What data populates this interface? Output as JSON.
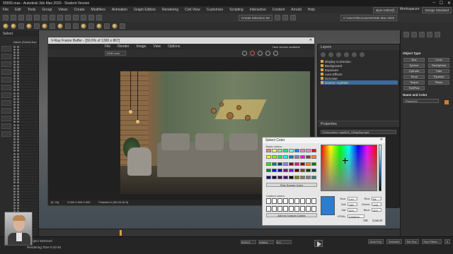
{
  "titlebar": {
    "title": "55555.max - Autodesk 3ds Max 2020 - Student Version"
  },
  "menubar": {
    "items": [
      "File",
      "Edit",
      "Tools",
      "Group",
      "Views",
      "Create",
      "Modifiers",
      "Animation",
      "Graph Editors",
      "Rendering",
      "Civil View",
      "Customize",
      "Scripting",
      "Interactive",
      "Content",
      "Arnold",
      "Help"
    ],
    "user": "alym-m6b4@",
    "workspace_label": "Workspaces:",
    "workspace_value": "Design Standard"
  },
  "toolbar": {
    "selection_set": "Create Selection Se",
    "path": "C:\\Users\\\\Documents\\3ds Max 2020"
  },
  "leftpanel": {
    "header": "Select",
    "column_header": "Name (Sorted Asc"
  },
  "vfb": {
    "title": "V-Ray Frame Buffer - [50.0% of 1300 x 867]",
    "menu": [
      "File",
      "Render",
      "Image",
      "View",
      "Options"
    ],
    "channel": "RGB color",
    "new_version": "New version available",
    "status_left": "[0, 40]",
    "status_mid": "0.000 0.000 0.000",
    "status_right": "Finished in [00:09:16.5]"
  },
  "layers": {
    "header": "Layers",
    "items": [
      {
        "label": "Display Correction",
        "sel": false
      },
      {
        "label": "Background",
        "sel": false
      },
      {
        "label": "Exposure",
        "sel": false
      },
      {
        "label": "Lens Effects",
        "sel": false
      },
      {
        "label": "Denoiser",
        "sel": false
      },
      {
        "label": "Source: LightMix",
        "sel": true
      }
    ],
    "props_header": "Properties",
    "props_field": "Photometric Light001_VRaySkyLight"
  },
  "cmdpanel": {
    "section1": "Object Type",
    "buttons": [
      "Box",
      "Cone",
      "Sphere",
      "GeoSphere",
      "Cylinder",
      "Tube",
      "Torus",
      "Pyramid",
      "Teapot",
      "Plane",
      "TextPlus"
    ],
    "section2": "Name and Color",
    "name_value": "Plane012"
  },
  "colordlg": {
    "title": "Select Color",
    "basic_label": "Basic colors:",
    "pick_label": "Pick Screen Color",
    "custom_label": "Custom colors:",
    "add_label": "Add to Custom Colors",
    "fields": [
      {
        "n": "Hue:",
        "v": "210"
      },
      {
        "n": "Sat:",
        "v": "190"
      },
      {
        "n": "Val:",
        "v": "203"
      },
      {
        "n": "Red:",
        "v": "54"
      },
      {
        "n": "Green:",
        "v": "128"
      },
      {
        "n": "Blue:",
        "v": "203"
      }
    ],
    "html_label": "HTML:",
    "html_value": "#3680cb",
    "ok": "OK",
    "cancel": "Cancel",
    "swatch_colors": [
      "#ff8080",
      "#ffff80",
      "#80ff80",
      "#00ff80",
      "#80ffff",
      "#0080ff",
      "#ff80c0",
      "#ff80ff",
      "#ff0000",
      "#ffff00",
      "#80ff00",
      "#00ff40",
      "#00ffff",
      "#0080c0",
      "#8080c0",
      "#ff00ff",
      "#804040",
      "#ff8040",
      "#00ff00",
      "#008080",
      "#004080",
      "#8080ff",
      "#800040",
      "#ff0080",
      "#800000",
      "#ff8000",
      "#008000",
      "#008040",
      "#0000ff",
      "#0000a0",
      "#800080",
      "#8000ff",
      "#400000",
      "#804000",
      "#004000",
      "#004040",
      "#000080",
      "#000040",
      "#400040",
      "#400080",
      "#000000",
      "#808000",
      "#808040",
      "#808080",
      "#408080"
    ]
  },
  "statusbar": {
    "line1": "1 Object Selected",
    "line2": "Rendering Time 0:43:46",
    "coord_x": "3053.5",
    "coord_y": "1088.6",
    "coord_z": "0.0",
    "autokey": "Auto Key",
    "selected": "Selected",
    "setkey": "Set Key",
    "keyfilters": "Key Filters...",
    "frame": "0"
  }
}
